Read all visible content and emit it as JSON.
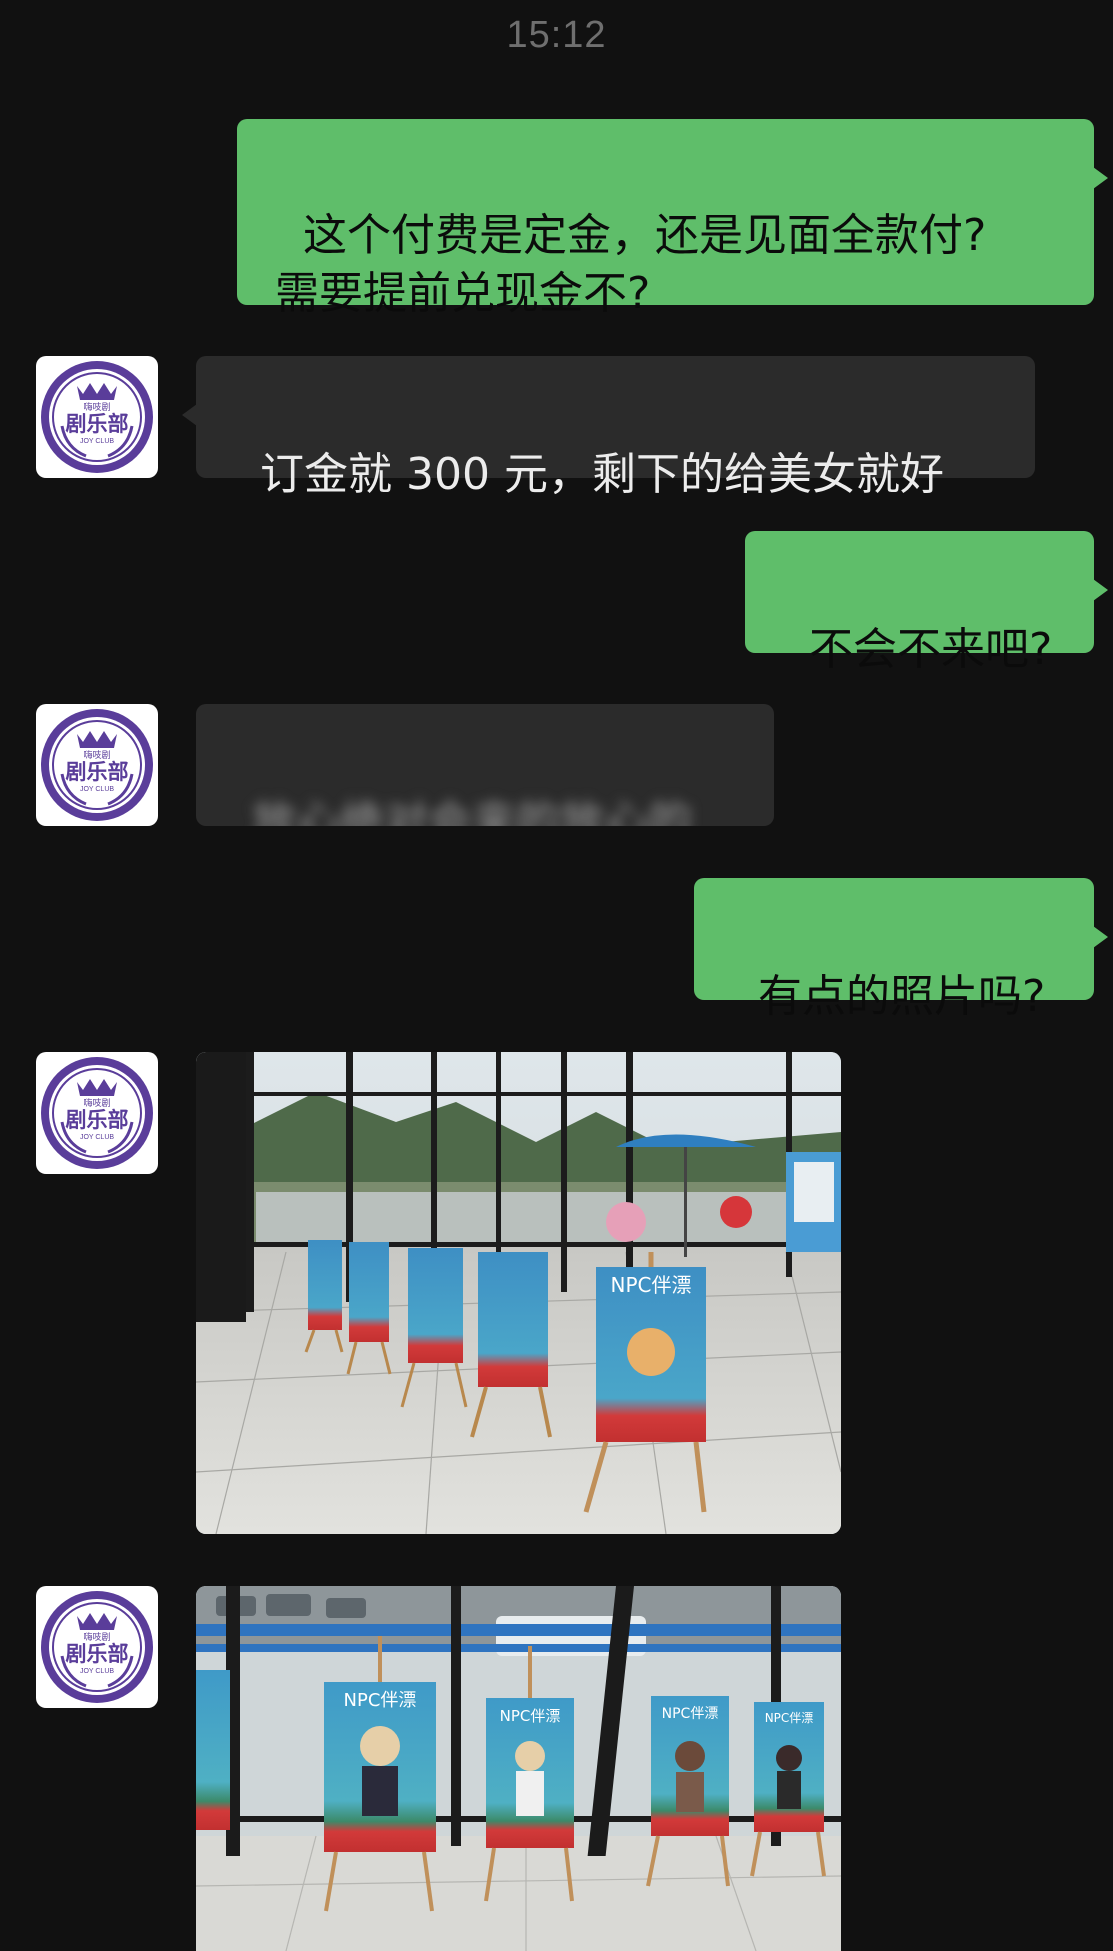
{
  "status": {
    "time": "15:12"
  },
  "contact": {
    "avatar_top_text": "嗨吱剧",
    "avatar_main_text": "剧乐部",
    "avatar_sub_text": "JOY CLUB"
  },
  "messages": [
    {
      "direction": "outgoing",
      "text": "这个付费是定金，还是见面全款付?\n需要提前兑现金不?"
    },
    {
      "direction": "incoming",
      "text": "订金就 300 元，剩下的给美女就好"
    },
    {
      "direction": "outgoing",
      "text": "不会不来吧?"
    },
    {
      "direction": "incoming",
      "text": "放心绝对会来的放心的",
      "obscured": true
    },
    {
      "direction": "outgoing",
      "text": "有点的照片吗?"
    },
    {
      "direction": "incoming",
      "type": "image",
      "description_icon": "photo-lobby-easels"
    },
    {
      "direction": "incoming",
      "type": "image",
      "description_icon": "photo-window-posters"
    }
  ],
  "photos": {
    "poster_label": "NPC伴漂"
  },
  "colors": {
    "background": "#111111",
    "outgoing_bubble": "#5fbe6a",
    "incoming_bubble": "#2b2b2b",
    "avatar_purple": "#5a3d9a"
  }
}
